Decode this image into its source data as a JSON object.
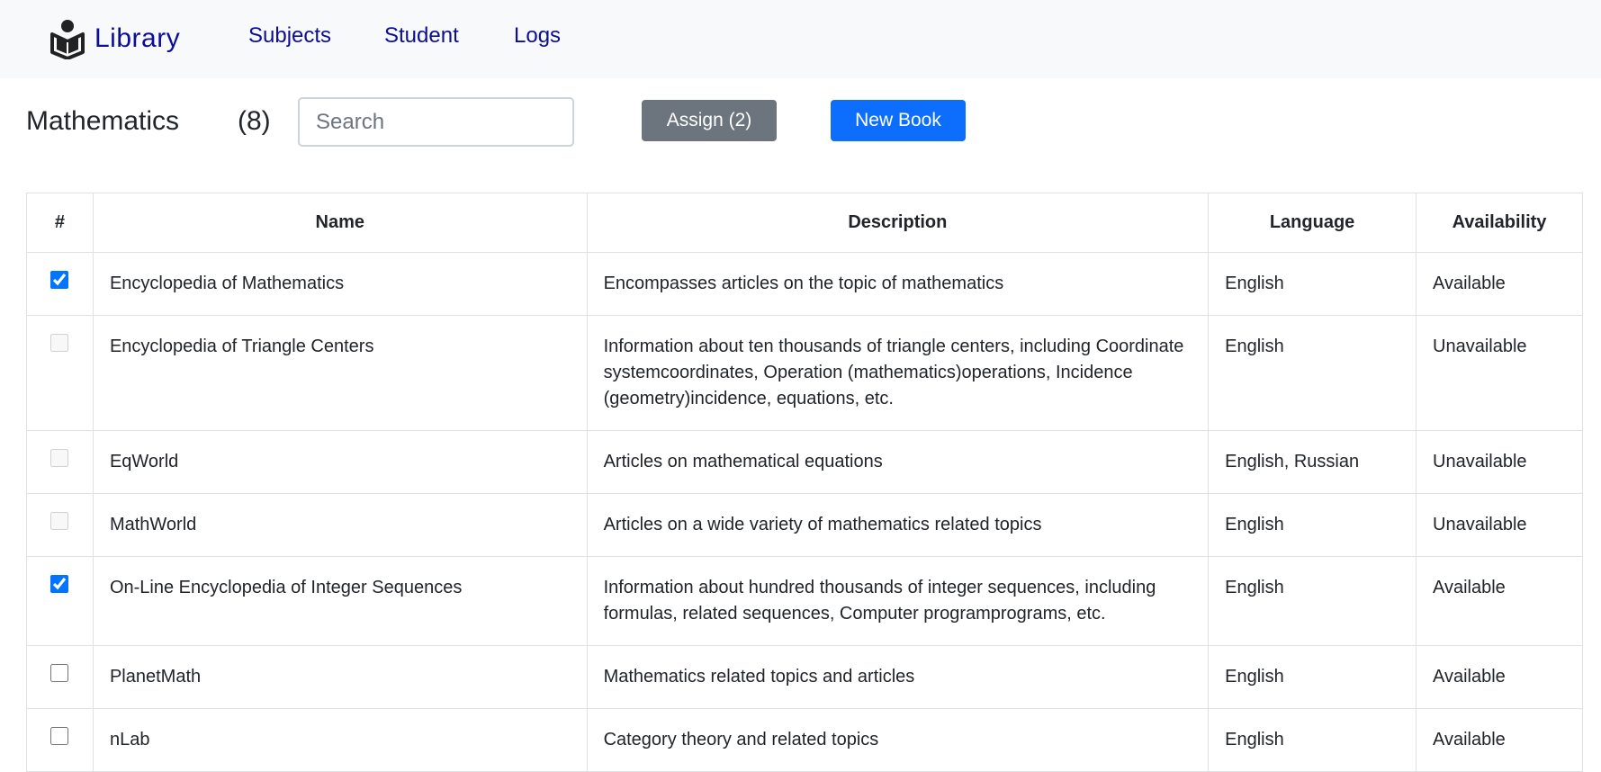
{
  "navbar": {
    "brand": "Library",
    "brand_icon": "reader-book-icon",
    "links": [
      "Subjects",
      "Student",
      "Logs"
    ]
  },
  "header": {
    "title": "Mathematics",
    "count": "(8)",
    "search_placeholder": "Search",
    "assign_label": "Assign (2)",
    "new_book_label": "New Book"
  },
  "table": {
    "columns": [
      "#",
      "Name",
      "Description",
      "Language",
      "Availability"
    ],
    "rows": [
      {
        "checked": true,
        "disabled": false,
        "name": "Encyclopedia of Mathematics",
        "description": "Encompasses articles on the topic of mathematics",
        "language": "English",
        "availability": "Available"
      },
      {
        "checked": false,
        "disabled": true,
        "name": "Encyclopedia of Triangle Centers",
        "description": "Information about ten thousands of triangle centers, including Coordinate systemcoordinates, Operation (mathematics)operations, Incidence (geometry)incidence, equations, etc.",
        "language": "English",
        "availability": "Unavailable"
      },
      {
        "checked": false,
        "disabled": true,
        "name": "EqWorld",
        "description": "Articles on mathematical equations",
        "language": "English, Russian",
        "availability": "Unavailable"
      },
      {
        "checked": false,
        "disabled": true,
        "name": "MathWorld",
        "description": "Articles on a wide variety of mathematics related topics",
        "language": "English",
        "availability": "Unavailable"
      },
      {
        "checked": true,
        "disabled": false,
        "name": "On-Line Encyclopedia of Integer Sequences",
        "description": "Information about hundred thousands of integer sequences, including formulas, related sequences, Computer programprograms, etc.",
        "language": "English",
        "availability": "Available"
      },
      {
        "checked": false,
        "disabled": false,
        "name": "PlanetMath",
        "description": "Mathematics related topics and articles",
        "language": "English",
        "availability": "Available"
      },
      {
        "checked": false,
        "disabled": false,
        "name": "nLab",
        "description": "Category theory and related topics",
        "language": "English",
        "availability": "Available"
      }
    ]
  },
  "colors": {
    "navbar_bg": "#f8f9fa",
    "brand": "#0d0d96",
    "assign_button": "#6c757d",
    "new_button": "#0d6efd"
  }
}
